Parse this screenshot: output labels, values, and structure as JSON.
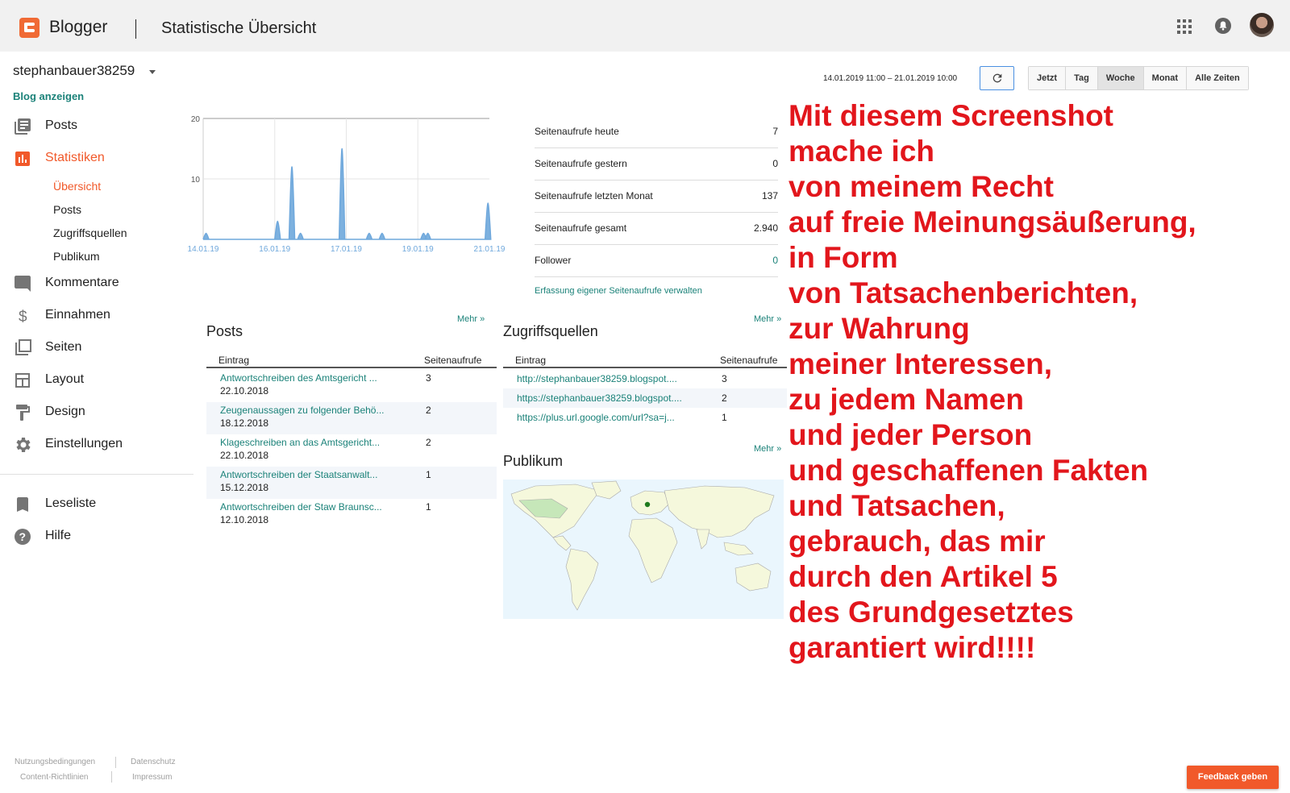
{
  "header": {
    "brand": "Blogger",
    "title": "Statistische Übersicht"
  },
  "sidebar": {
    "blog_name": "stephanbauer38259",
    "view_blog": "Blog anzeigen",
    "items": [
      {
        "label": "Posts",
        "icon": "posts-icon"
      },
      {
        "label": "Statistiken",
        "icon": "stats-icon"
      },
      {
        "label": "Kommentare",
        "icon": "comment-icon"
      },
      {
        "label": "Einnahmen",
        "icon": "dollar-icon"
      },
      {
        "label": "Seiten",
        "icon": "pages-icon"
      },
      {
        "label": "Layout",
        "icon": "layout-icon"
      },
      {
        "label": "Design",
        "icon": "paint-roller-icon"
      },
      {
        "label": "Einstellungen",
        "icon": "gear-icon"
      },
      {
        "label": "Leseliste",
        "icon": "bookmark-icon"
      },
      {
        "label": "Hilfe",
        "icon": "help-icon"
      }
    ],
    "sub_items": [
      "Übersicht",
      "Posts",
      "Zugriffsquellen",
      "Publikum"
    ],
    "footer": [
      "Nutzungsbedingungen",
      "Datenschutz",
      "Content-Richtlinien",
      "Impressum"
    ]
  },
  "controls": {
    "date_range": "14.01.2019 11:00 – 21.01.2019 10:00",
    "ranges": [
      "Jetzt",
      "Tag",
      "Woche",
      "Monat",
      "Alle Zeiten"
    ],
    "selected_range": "Woche"
  },
  "chart_data": {
    "type": "area",
    "x_tick_labels": [
      "14.01.19",
      "16.01.19",
      "17.01.19",
      "19.01.19",
      "21.01.19"
    ],
    "y_ticks": [
      10,
      20
    ],
    "ylim": [
      0,
      20
    ],
    "grid": true,
    "color": "#6fa8dc",
    "peaks": [
      {
        "x": 0.01,
        "y": 1
      },
      {
        "x": 0.26,
        "y": 3
      },
      {
        "x": 0.31,
        "y": 12
      },
      {
        "x": 0.34,
        "y": 1
      },
      {
        "x": 0.485,
        "y": 15
      },
      {
        "x": 0.58,
        "y": 1
      },
      {
        "x": 0.625,
        "y": 1
      },
      {
        "x": 0.77,
        "y": 1
      },
      {
        "x": 0.785,
        "y": 1
      },
      {
        "x": 0.995,
        "y": 6
      }
    ]
  },
  "stats": [
    {
      "label": "Seitenaufrufe heute",
      "value": "7"
    },
    {
      "label": "Seitenaufrufe gestern",
      "value": "0"
    },
    {
      "label": "Seitenaufrufe letzten Monat",
      "value": "137"
    },
    {
      "label": "Seitenaufrufe gesamt",
      "value": "2.940"
    },
    {
      "label": "Follower",
      "value": "0"
    }
  ],
  "stats_manage": "Erfassung eigener Seitenaufrufe verwalten",
  "posts_panel": {
    "title": "Posts",
    "more": "Mehr »",
    "col_entry": "Eintrag",
    "col_views": "Seitenaufrufe",
    "rows": [
      {
        "title": "Antwortschreiben des Amtsgericht ...",
        "date": "22.10.2018",
        "views": "3"
      },
      {
        "title": "Zeugenaussagen zu folgender Behö...",
        "date": "18.12.2018",
        "views": "2"
      },
      {
        "title": "Klageschreiben an das Amtsgericht...",
        "date": "22.10.2018",
        "views": "2"
      },
      {
        "title": "Antwortschreiben der Staatsanwalt...",
        "date": "15.12.2018",
        "views": "1"
      },
      {
        "title": "Antwortschreiben der Staw Braunsc...",
        "date": "12.10.2018",
        "views": "1"
      }
    ]
  },
  "sources_panel": {
    "title": "Zugriffsquellen",
    "more": "Mehr »",
    "col_entry": "Eintrag",
    "col_views": "Seitenaufrufe",
    "rows": [
      {
        "url": "http://stephanbauer38259.blogspot....",
        "views": "3"
      },
      {
        "url": "https://stephanbauer38259.blogspot....",
        "views": "2"
      },
      {
        "url": "https://plus.url.google.com/url?sa=j...",
        "views": "1"
      }
    ]
  },
  "audience_panel": {
    "title": "Publikum",
    "more": "Mehr »"
  },
  "overlay_lines": [
    "Mit diesem Screenshot",
    "mache ich",
    "von meinem Recht",
    "auf freie Meinungsäußerung,",
    "in Form",
    "von Tatsachenberichten,",
    "zur Wahrung",
    "meiner Interessen,",
    "zu jedem Namen",
    "und jeder Person",
    "und geschaffenen Fakten",
    "und Tatsachen,",
    "gebrauch, das mir",
    "durch den Artikel 5",
    "des Grundgesetztes",
    "garantiert wird!!!!"
  ],
  "feedback": "Feedback geben"
}
